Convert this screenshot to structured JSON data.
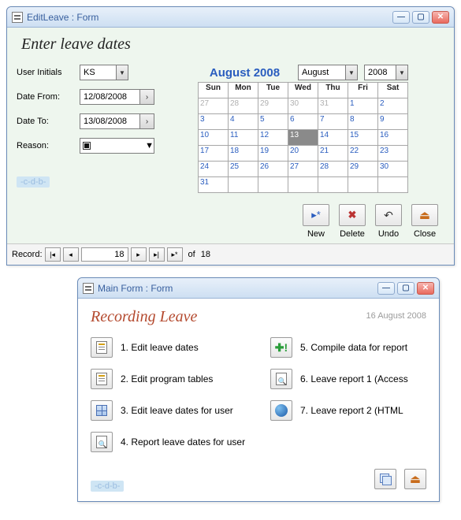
{
  "win1": {
    "title": "EditLeave : Form",
    "heading": "Enter leave dates",
    "labels": {
      "initials": "User Initials",
      "from": "Date From:",
      "to": "Date To:",
      "reason": "Reason:"
    },
    "values": {
      "initials": "KS",
      "from": "12/08/2008",
      "to": "13/08/2008"
    },
    "calendar": {
      "title": "August 2008",
      "month": "August",
      "year": "2008",
      "dow": [
        "Sun",
        "Mon",
        "Tue",
        "Wed",
        "Thu",
        "Fri",
        "Sat"
      ],
      "rows": [
        [
          {
            "n": "27",
            "dim": true
          },
          {
            "n": "28",
            "dim": true
          },
          {
            "n": "29",
            "dim": true
          },
          {
            "n": "30",
            "dim": true
          },
          {
            "n": "31",
            "dim": true
          },
          {
            "n": "1"
          },
          {
            "n": "2"
          }
        ],
        [
          {
            "n": "3"
          },
          {
            "n": "4"
          },
          {
            "n": "5"
          },
          {
            "n": "6"
          },
          {
            "n": "7"
          },
          {
            "n": "8"
          },
          {
            "n": "9"
          }
        ],
        [
          {
            "n": "10"
          },
          {
            "n": "11"
          },
          {
            "n": "12"
          },
          {
            "n": "13",
            "today": true
          },
          {
            "n": "14"
          },
          {
            "n": "15"
          },
          {
            "n": "16"
          }
        ],
        [
          {
            "n": "17"
          },
          {
            "n": "18"
          },
          {
            "n": "19"
          },
          {
            "n": "20"
          },
          {
            "n": "21"
          },
          {
            "n": "22"
          },
          {
            "n": "23"
          }
        ],
        [
          {
            "n": "24"
          },
          {
            "n": "25"
          },
          {
            "n": "26"
          },
          {
            "n": "27"
          },
          {
            "n": "28"
          },
          {
            "n": "29"
          },
          {
            "n": "30"
          }
        ],
        [
          {
            "n": "31"
          },
          {
            "n": ""
          },
          {
            "n": ""
          },
          {
            "n": ""
          },
          {
            "n": ""
          },
          {
            "n": ""
          },
          {
            "n": ""
          }
        ]
      ]
    },
    "toolbar": {
      "new": "New",
      "delete": "Delete",
      "undo": "Undo",
      "close": "Close"
    },
    "watermark": "-c-d-b-",
    "record": {
      "label": "Record:",
      "pos": "18",
      "of": "of",
      "total": "18"
    }
  },
  "win2": {
    "title": "Main Form : Form",
    "heading": "Recording Leave",
    "date": "16 August 2008",
    "menu": {
      "left": [
        "1. Edit leave dates",
        "2. Edit program tables",
        "3. Edit leave dates for user",
        "4. Report leave dates for user"
      ],
      "right": [
        "5. Compile data for report",
        "6. Leave report 1 (Access",
        "7. Leave report 2 (HTML"
      ]
    },
    "watermark": "-c-d-b-"
  }
}
